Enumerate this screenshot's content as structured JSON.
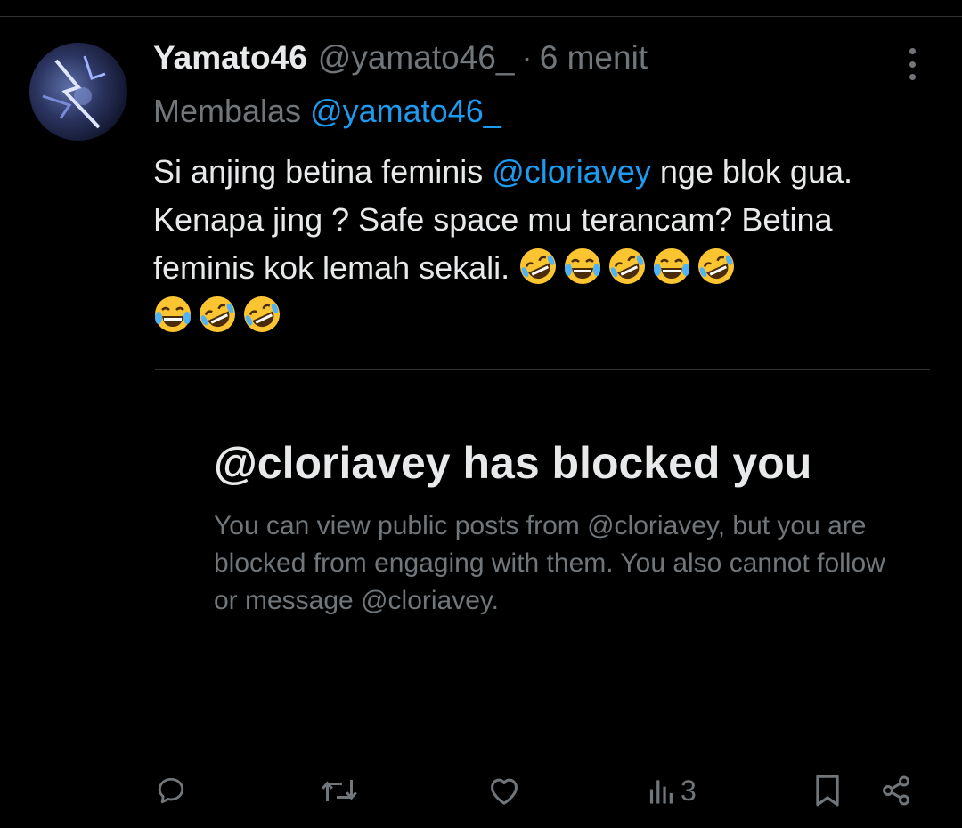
{
  "tweet": {
    "author_name": "Yamato46",
    "author_handle": "@yamato46_",
    "separator": "·",
    "time": "6 menit",
    "reply_prefix": "Membalas",
    "reply_to": "@yamato46_",
    "text_part1": "Si anjing betina feminis ",
    "text_mention": "@cloriavey",
    "text_part2": " nge blok gua. Kenapa jing ? Safe space mu terancam? Betina feminis kok lemah sekali.",
    "emojis": [
      "🤣",
      "😂",
      "🤣",
      "😂",
      "🤣",
      "😂",
      "🤣",
      "🤣"
    ]
  },
  "embedded_card": {
    "title": "@cloriavey has blocked you",
    "body": "You can view public posts from @cloriavey, but you are blocked from engaging with them. You also cannot follow or message @cloriavey."
  },
  "actions": {
    "reply_icon": "reply-icon",
    "retweet_icon": "retweet-icon",
    "like_icon": "like-icon",
    "views_icon": "views-icon",
    "views_count": "3",
    "bookmark_icon": "bookmark-icon",
    "share_icon": "share-icon"
  },
  "colors": {
    "background": "#000000",
    "text": "#e7e9ea",
    "muted": "#71767b",
    "accent": "#1d9bf0",
    "divider": "#2f3336"
  }
}
